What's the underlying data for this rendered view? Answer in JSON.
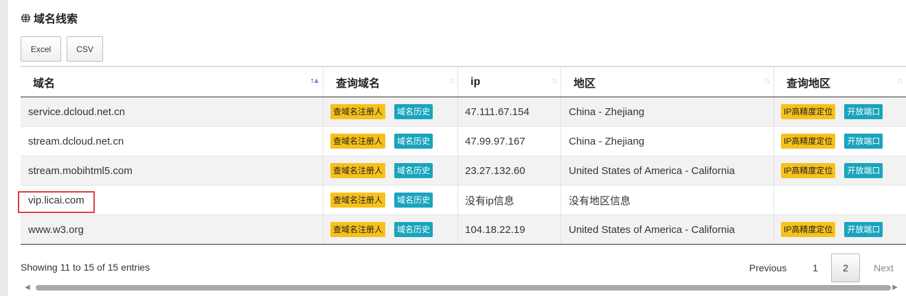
{
  "title": "域名线索",
  "buttons": {
    "excel": "Excel",
    "csv": "CSV"
  },
  "columns": [
    "域名",
    "查询域名",
    "ip",
    "地区",
    "查询地区"
  ],
  "rows": [
    {
      "domain": "service.dcloud.net.cn",
      "btn_registrant": "查域名注册人",
      "btn_history": "域名历史",
      "ip": "47.111.67.154",
      "region": "China - Zhejiang",
      "btn_geo": "IP高精度定位",
      "btn_ports": "开放端口"
    },
    {
      "domain": "stream.dcloud.net.cn",
      "btn_registrant": "查域名注册人",
      "btn_history": "域名历史",
      "ip": "47.99.97.167",
      "region": "China - Zhejiang",
      "btn_geo": "IP高精度定位",
      "btn_ports": "开放端口"
    },
    {
      "domain": "stream.mobihtml5.com",
      "btn_registrant": "查域名注册人",
      "btn_history": "域名历史",
      "ip": "23.27.132.60",
      "region": "United States of America - California",
      "btn_geo": "IP高精度定位",
      "btn_ports": "开放端口"
    },
    {
      "domain": "vip.licai.com",
      "btn_registrant": "查域名注册人",
      "btn_history": "域名历史",
      "ip": "没有ip信息",
      "region": "没有地区信息",
      "btn_geo": "",
      "btn_ports": ""
    },
    {
      "domain": "www.w3.org",
      "btn_registrant": "查域名注册人",
      "btn_history": "域名历史",
      "ip": "104.18.22.19",
      "region": "United States of America - California",
      "btn_geo": "IP高精度定位",
      "btn_ports": "开放端口"
    }
  ],
  "info": "Showing 11 to 15 of 15 entries",
  "pagination": {
    "previous": "Previous",
    "pages": [
      "1",
      "2"
    ],
    "current": "2",
    "next": "Next"
  },
  "icons": {
    "title": "globe-icon",
    "sort": "sort-arrows-icon"
  },
  "colors": {
    "yellow_badge": "#f7c11b",
    "teal_badge": "#19a4bd",
    "highlight": "#e03b3b"
  }
}
